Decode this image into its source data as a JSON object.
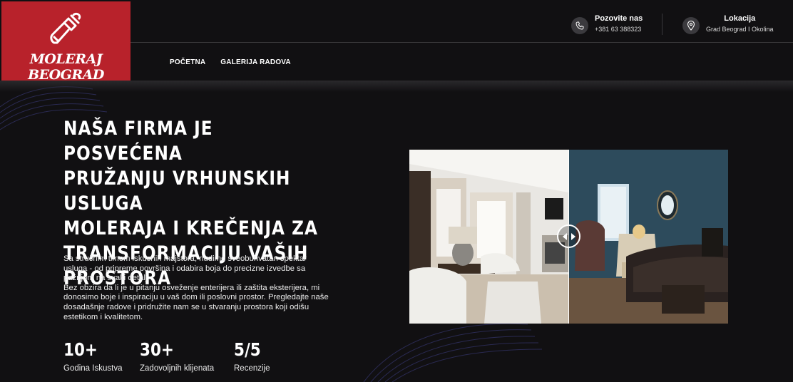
{
  "brand": {
    "name": "MOLERAJ BEOGRAD"
  },
  "contacts": [
    {
      "title": "Pozovite nas",
      "value": "+381 63 388323",
      "icon": "phone-icon"
    },
    {
      "title": "Lokacija",
      "value": "Grad Beograd I Okolina",
      "icon": "location-pin-icon"
    }
  ],
  "nav": {
    "items": [
      {
        "label": "POČETNA"
      },
      {
        "label": "GALERIJA RADOVA"
      }
    ]
  },
  "hero": {
    "title_lines": [
      "NAŠA FIRMA JE POSVEĆENA",
      "PRUŽANJU VRHUNSKIH USLUGA",
      "MOLERAJA I KREČENJA ZA",
      "TRANSFORMACIJU VAŠIH",
      "PROSTORA"
    ],
    "description_lines": [
      "Sa stručnim timom iskusnih majstora, nudimo sveobuhvatan spektar",
      "usluga - od pripreme površina i odabira boja do precizne izvedbe sa",
      "pažnjom na svaki detalj.",
      "Bez obzira da li je u pitanju osveženje enterijera ili zaštita eksterijera, mi",
      "donosimo boje i inspiraciju u vaš dom ili poslovni prostor. Pregledajte naše",
      "dosadašnje radove i pridružite nam se u stvaranju prostora koji odišu",
      "estetikom i kvalitetom."
    ]
  },
  "stats": [
    {
      "value": "10+",
      "label": "Godina Iskustva"
    },
    {
      "value": "30+",
      "label": "Zadovoljnih klijenata"
    },
    {
      "value": "5/5",
      "label": "Recenzije"
    }
  ],
  "colors": {
    "brand_red": "#b8222b",
    "background": "#111012",
    "icon_circle": "#3b3a3e",
    "after_wall": "#2d4b5c"
  }
}
